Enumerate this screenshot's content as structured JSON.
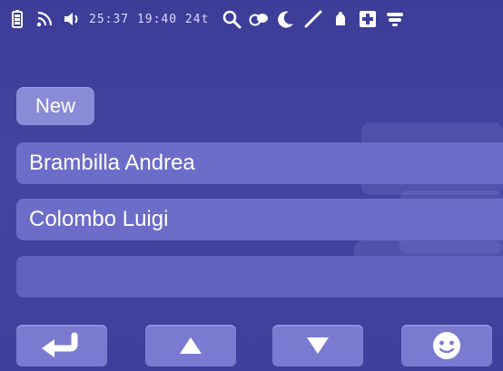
{
  "status_bar": {
    "time_readout": "25:37  19:40  24t"
  },
  "list": {
    "new_label": "New",
    "entries": [
      {
        "label": "Brambilla Andrea"
      },
      {
        "label": "Colombo Luigi"
      },
      {
        "label": ""
      }
    ]
  },
  "icons": {
    "status": [
      "battery-icon",
      "wifi-icon",
      "speaker-icon",
      "search-icon",
      "chat-bubble-icon",
      "moon-icon",
      "pen-icon",
      "bell-icon",
      "plus-icon",
      "menu-icon"
    ],
    "bottom": [
      "back-arrow-icon",
      "arrow-up-icon",
      "arrow-down-icon",
      "smiley-icon"
    ]
  },
  "colors": {
    "background": "#3e3f9a",
    "row": "#6c6dc8",
    "new_button": "#8a8bd6",
    "bottom_button": "#7a7bd0"
  }
}
